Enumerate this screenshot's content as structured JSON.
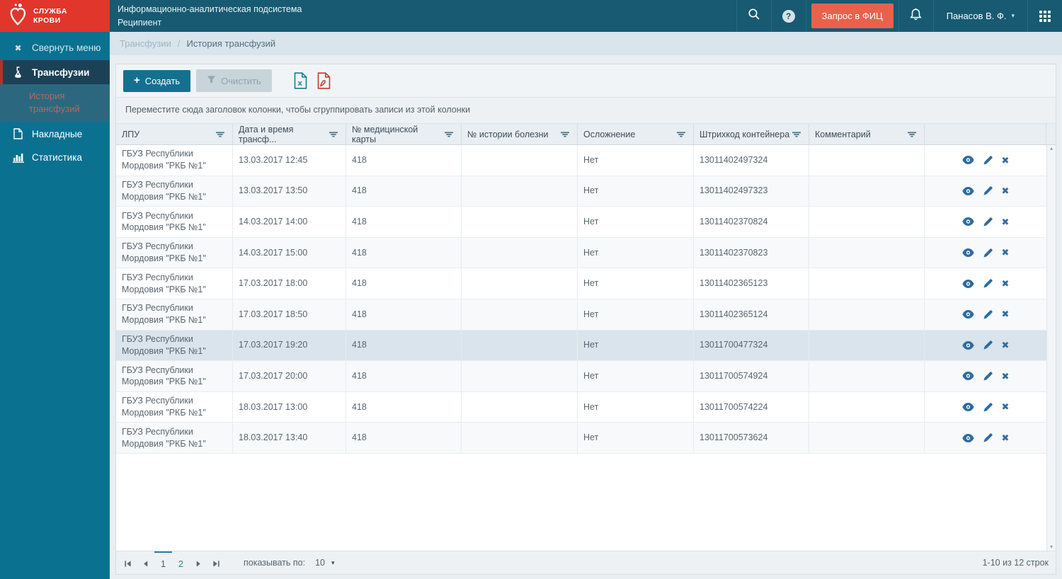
{
  "colors": {
    "topbar": "#175a72",
    "sidebar": "#0b7190",
    "logo_red": "#e0362c",
    "accent_teal": "#13718f",
    "fic_orange": "#e8614d",
    "action_blue": "#2d6ca2",
    "selected_row": "#d9e4ec",
    "active_item_bg": "#1c4156",
    "active_item_border": "#b23327"
  },
  "icons": {
    "close": "✖",
    "delete": "✖",
    "plus": "+",
    "help": "?",
    "caret_down": "▾",
    "scroll_up": "▴",
    "scroll_down": "▾"
  },
  "logo": {
    "line1": "СЛУЖБА",
    "line2": "КРОВИ"
  },
  "topbar": {
    "title_line1": "Информационно-аналитическая подсистема",
    "title_line2": "Реципиент",
    "fic_button": "Запрос в ФИЦ",
    "user_name": "Панасов В. Ф."
  },
  "sidebar": {
    "collapse_label": "Свернуть меню",
    "items": [
      {
        "label": "Трансфузии",
        "icon": "flask-icon",
        "active": true
      },
      {
        "label": "Накладные",
        "icon": "document-icon",
        "active": false
      },
      {
        "label": "Статистика",
        "icon": "chart-icon",
        "active": false
      }
    ],
    "subitem": {
      "label": "История трансфузий",
      "active": true
    }
  },
  "breadcrumb": {
    "parent": "Трансфузии",
    "separator": "/",
    "current": "История трансфузий"
  },
  "toolbar": {
    "create_label": "Создать",
    "clear_label": "Очистить",
    "export_excel": "excel-export-icon",
    "export_pdf": "pdf-export-icon"
  },
  "grid": {
    "group_hint": "Переместите сюда заголовок колонки, чтобы сгруппировать записи из этой колонки",
    "columns": [
      "ЛПУ",
      "Дата и время трансф...",
      "№ медицинской карты",
      "№ истории болезни",
      "Осложнение",
      "Штрихкод контейнера",
      "Комментарий",
      ""
    ],
    "rows": [
      {
        "lpu": "ГБУЗ Республики Мордовия \"РКБ №1\"",
        "datetime": "13.03.2017 12:45",
        "card": "418",
        "history": "",
        "complication": "Нет",
        "barcode": "13011402497324",
        "comment": "",
        "selected": false
      },
      {
        "lpu": "ГБУЗ Республики Мордовия \"РКБ №1\"",
        "datetime": "13.03.2017 13:50",
        "card": "418",
        "history": "",
        "complication": "Нет",
        "barcode": "13011402497323",
        "comment": "",
        "selected": false
      },
      {
        "lpu": "ГБУЗ Республики Мордовия \"РКБ №1\"",
        "datetime": "14.03.2017 14:00",
        "card": "418",
        "history": "",
        "complication": "Нет",
        "barcode": "13011402370824",
        "comment": "",
        "selected": false
      },
      {
        "lpu": "ГБУЗ Республики Мордовия \"РКБ №1\"",
        "datetime": "14.03.2017 15:00",
        "card": "418",
        "history": "",
        "complication": "Нет",
        "barcode": "13011402370823",
        "comment": "",
        "selected": false
      },
      {
        "lpu": "ГБУЗ Республики Мордовия \"РКБ №1\"",
        "datetime": "17.03.2017 18:00",
        "card": "418",
        "history": "",
        "complication": "Нет",
        "barcode": "13011402365123",
        "comment": "",
        "selected": false
      },
      {
        "lpu": "ГБУЗ Республики Мордовия \"РКБ №1\"",
        "datetime": "17.03.2017 18:50",
        "card": "418",
        "history": "",
        "complication": "Нет",
        "barcode": "13011402365124",
        "comment": "",
        "selected": false
      },
      {
        "lpu": "ГБУЗ Республики Мордовия \"РКБ №1\"",
        "datetime": "17.03.2017 19:20",
        "card": "418",
        "history": "",
        "complication": "Нет",
        "barcode": "13011700477324",
        "comment": "",
        "selected": true
      },
      {
        "lpu": "ГБУЗ Республики Мордовия \"РКБ №1\"",
        "datetime": "17.03.2017 20:00",
        "card": "418",
        "history": "",
        "complication": "Нет",
        "barcode": "13011700574924",
        "comment": "",
        "selected": false
      },
      {
        "lpu": "ГБУЗ Республики Мордовия \"РКБ №1\"",
        "datetime": "18.03.2017 13:00",
        "card": "418",
        "history": "",
        "complication": "Нет",
        "barcode": "13011700574224",
        "comment": "",
        "selected": false
      },
      {
        "lpu": "ГБУЗ Республики Мордовия \"РКБ №1\"",
        "datetime": "18.03.2017 13:40",
        "card": "418",
        "history": "",
        "complication": "Нет",
        "barcode": "13011700573624",
        "comment": "",
        "selected": false
      }
    ]
  },
  "pager": {
    "pages": [
      "1",
      "2"
    ],
    "current_page": "1",
    "page_size_label": "показывать по:",
    "page_size": "10",
    "info": "1-10 из 12 строк"
  }
}
